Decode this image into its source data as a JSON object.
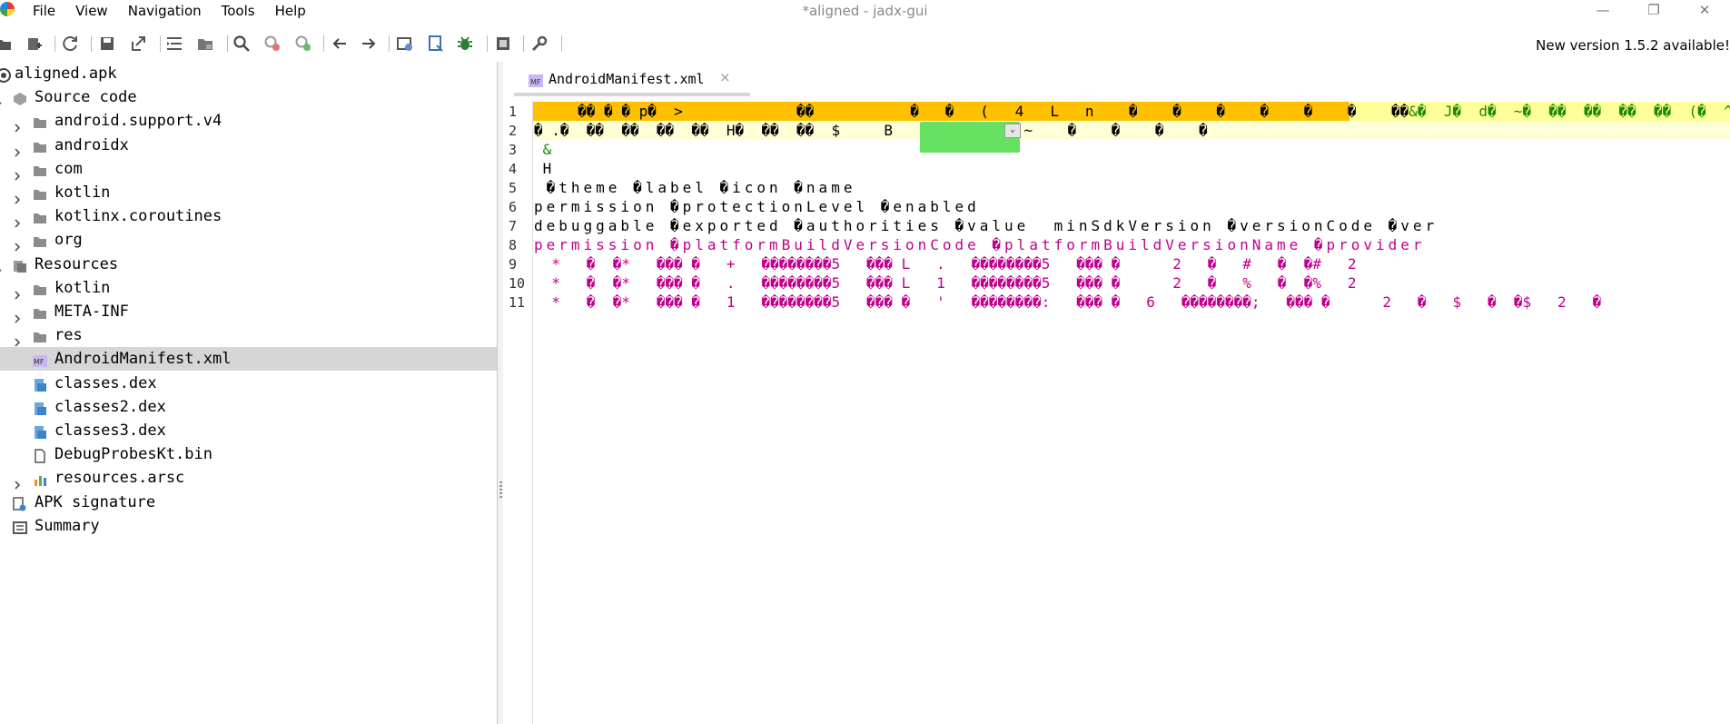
{
  "menu": [
    "File",
    "View",
    "Navigation",
    "Tools",
    "Help"
  ],
  "window_title": "*aligned - jadx-gui",
  "window_controls": [
    "—",
    "❐",
    "✕"
  ],
  "toolbar": {
    "new_version": "New version 1.5.2 available!",
    "icons": [
      "open-file-icon",
      "add-files-icon",
      "reload-icon",
      "save-all-icon",
      "export-icon",
      "sync-tree-icon",
      "flatten-packages-icon",
      "search-icon",
      "find-usage-icon",
      "deobfuscation-icon",
      "back-icon",
      "forward-icon",
      "quark-icon",
      "log-viewer-icon",
      "debugger-icon",
      "stop-icon",
      "preferences-icon"
    ]
  },
  "tree": {
    "items": [
      {
        "label": "aligned.apk",
        "icon": "apk-icon",
        "arrow": "",
        "level": 0
      },
      {
        "label": "Source code",
        "icon": "package-icon",
        "arrow": "down",
        "level": 1
      },
      {
        "label": "android.support.v4",
        "icon": "folder-icon",
        "arrow": "right",
        "level": 2
      },
      {
        "label": "androidx",
        "icon": "folder-icon",
        "arrow": "right",
        "level": 2
      },
      {
        "label": "com",
        "icon": "folder-icon",
        "arrow": "right",
        "level": 2
      },
      {
        "label": "kotlin",
        "icon": "folder-icon",
        "arrow": "right",
        "level": 2
      },
      {
        "label": "kotlinx.coroutines",
        "icon": "folder-icon",
        "arrow": "right",
        "level": 2
      },
      {
        "label": "org",
        "icon": "folder-icon",
        "arrow": "right",
        "level": 2
      },
      {
        "label": "Resources",
        "icon": "resources-icon",
        "arrow": "down",
        "level": 1
      },
      {
        "label": "kotlin",
        "icon": "folder-icon",
        "arrow": "right",
        "level": 2
      },
      {
        "label": "META-INF",
        "icon": "folder-icon",
        "arrow": "right",
        "level": 2
      },
      {
        "label": "res",
        "icon": "folder-icon",
        "arrow": "right",
        "level": 2
      },
      {
        "label": "AndroidManifest.xml",
        "icon": "manifest-icon",
        "arrow": "",
        "level": 2,
        "selected": true
      },
      {
        "label": "classes.dex",
        "icon": "dex-icon",
        "arrow": "",
        "level": 2
      },
      {
        "label": "classes2.dex",
        "icon": "dex-icon",
        "arrow": "",
        "level": 2
      },
      {
        "label": "classes3.dex",
        "icon": "dex-icon",
        "arrow": "",
        "level": 2
      },
      {
        "label": "DebugProbesKt.bin",
        "icon": "file-icon",
        "arrow": "",
        "level": 2
      },
      {
        "label": "resources.arsc",
        "icon": "arsc-icon",
        "arrow": "right",
        "level": 2
      },
      {
        "label": "APK signature",
        "icon": "signature-icon",
        "arrow": "",
        "level": 1
      },
      {
        "label": "Summary",
        "icon": "summary-icon",
        "arrow": "",
        "level": 1
      }
    ]
  },
  "editor": {
    "tab_label": "AndroidManifest.xml",
    "tab_close": "×",
    "popup_tag": "⌄",
    "line_numbers": [
      "1",
      "2",
      "3",
      "4",
      "5",
      "6",
      "7",
      "8",
      "9",
      "10",
      "11"
    ],
    "lines": [
      {
        "text": "     �� � � p�  >             ��           �   �   (   4   L   n    �    �    �    �    �    �    ��",
        "tail": "&�  J�  d�  ~�  ��  ��  ��  ��  (�  ^�  ��",
        "color": "dark"
      },
      {
        "text": "� .�  ��  ��  ��  ��  H�  ��  ��  $     B    V    l  �  ~    �    �    �    �",
        "color": "dark"
      },
      {
        "text": " &",
        "color": "green"
      },
      {
        "text": " H",
        "color": "dark"
      },
      {
        "text": " �theme �label �icon �name",
        "color": "dark",
        "spaced": true
      },
      {
        "text": "permission �protectionLevel �enabled",
        "color": "dark",
        "spaced": true
      },
      {
        "text": "debuggable �exported �authorities �value  minSdkVersion �versionCode �ver",
        "color": "dark",
        "spaced": true
      },
      {
        "text": "permission �platformBuildVersionCode �platformBuildVersionName �provider",
        "color": "magenta",
        "spaced": true
      },
      {
        "text": "  *   �  �*   ��� �   +   ��������5   ��� L   .   ��������5   ��� �      2   �   #   �  �#   2",
        "color": "magenta"
      },
      {
        "text": "  *   �  �*   ��� �   .   ��������5   ��� L   1   ��������5   ��� �      2   �   %   �  �%   2",
        "color": "magenta"
      },
      {
        "text": "  *   �  �*   ��� �   1   ��������5   ��� �   '   ��������:   ��� �   6   ��������;   ��� �      2   �   $   �  �$   2   �",
        "color": "magenta"
      }
    ]
  }
}
